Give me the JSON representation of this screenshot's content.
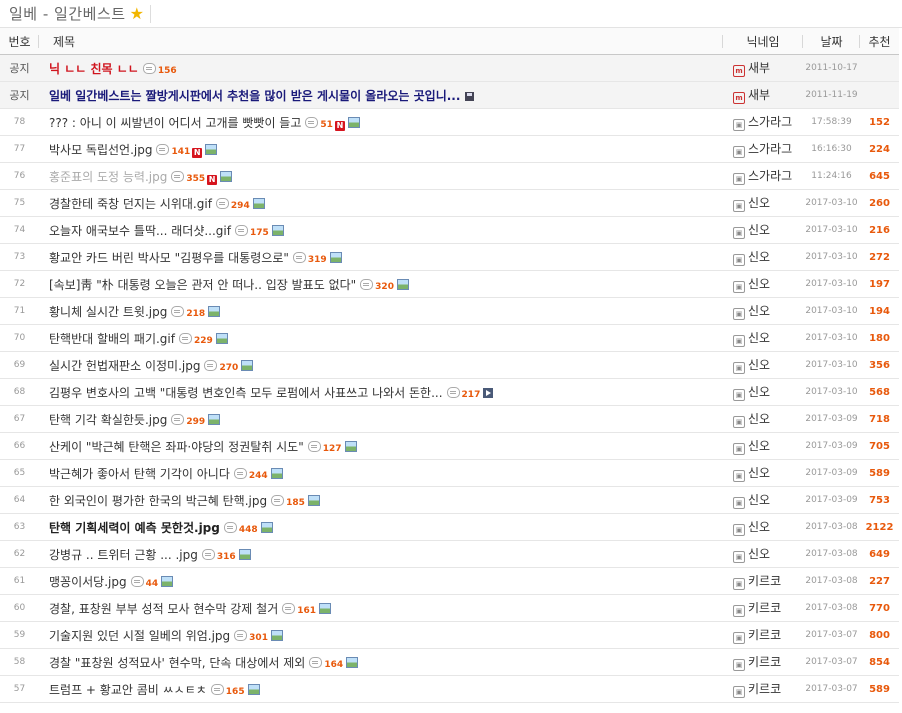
{
  "board": {
    "title": "일베 - 일간베스트",
    "star_icon": "star-icon"
  },
  "columns": {
    "no": "번호",
    "title": "제목",
    "nick": "닉네임",
    "date": "날짜",
    "rec": "추천"
  },
  "colors": {
    "accent": "#e8590c",
    "notice_red": "#d0141e",
    "notice_blue": "#1a1a7a"
  },
  "rows": [
    {
      "no": "공지",
      "title": "닉 ㄴㄴ 친목 ㄴㄴ",
      "comments": "156",
      "badge": "m",
      "nick": "새부",
      "date": "2011-10-17",
      "rec": "",
      "style": "red",
      "notice": true,
      "n": false,
      "img": false,
      "icon": ""
    },
    {
      "no": "공지",
      "title": "일베 일간베스트는 짤방게시판에서 추천을 많이 받은 게시물이 올라오는 곳입니...",
      "comments": "",
      "badge": "m",
      "nick": "새부",
      "date": "2011-11-19",
      "rec": "",
      "style": "blue",
      "notice": true,
      "n": false,
      "img": false,
      "icon": "disk"
    },
    {
      "no": "78",
      "title": "??? : 아니 이 씨발년이 어디서 고개를 빳빳이 들고",
      "comments": "51",
      "badge": "w",
      "nick": "스가라그",
      "date": "17:58:39",
      "rec": "152",
      "style": "",
      "notice": false,
      "n": true,
      "img": true,
      "icon": ""
    },
    {
      "no": "77",
      "title": "박사모 독립선언.jpg",
      "comments": "141",
      "badge": "w",
      "nick": "스가라그",
      "date": "16:16:30",
      "rec": "224",
      "style": "",
      "notice": false,
      "n": true,
      "img": true,
      "icon": ""
    },
    {
      "no": "76",
      "title": "홍준표의 도정 능력.jpg",
      "comments": "355",
      "badge": "w",
      "nick": "스가라그",
      "date": "11:24:16",
      "rec": "645",
      "style": "gray",
      "notice": false,
      "n": true,
      "img": true,
      "icon": ""
    },
    {
      "no": "75",
      "title": "경찰한테 죽창 던지는 시위대.gif",
      "comments": "294",
      "badge": "w",
      "nick": "신오",
      "date": "2017-03-10",
      "rec": "260",
      "style": "",
      "notice": false,
      "n": false,
      "img": true,
      "icon": ""
    },
    {
      "no": "74",
      "title": "오늘자 애국보수 틀딱... 래더샷...gif",
      "comments": "175",
      "badge": "w",
      "nick": "신오",
      "date": "2017-03-10",
      "rec": "216",
      "style": "",
      "notice": false,
      "n": false,
      "img": true,
      "icon": ""
    },
    {
      "no": "73",
      "title": "황교안 카드 버린 박사모 \"김평우를 대통령으로\"",
      "comments": "319",
      "badge": "w",
      "nick": "신오",
      "date": "2017-03-10",
      "rec": "272",
      "style": "",
      "notice": false,
      "n": false,
      "img": true,
      "icon": ""
    },
    {
      "no": "72",
      "title": "[속보]靑 \"朴 대통령 오늘은 관저 안 떠나.. 입장 발표도 없다\"",
      "comments": "320",
      "badge": "w",
      "nick": "신오",
      "date": "2017-03-10",
      "rec": "197",
      "style": "",
      "notice": false,
      "n": false,
      "img": true,
      "icon": ""
    },
    {
      "no": "71",
      "title": "황니체 실시간 트윗.jpg",
      "comments": "218",
      "badge": "w",
      "nick": "신오",
      "date": "2017-03-10",
      "rec": "194",
      "style": "",
      "notice": false,
      "n": false,
      "img": true,
      "icon": ""
    },
    {
      "no": "70",
      "title": "탄핵반대 할배의 패기.gif",
      "comments": "229",
      "badge": "w",
      "nick": "신오",
      "date": "2017-03-10",
      "rec": "180",
      "style": "",
      "notice": false,
      "n": false,
      "img": true,
      "icon": ""
    },
    {
      "no": "69",
      "title": "실시간 헌법재판소 이정미.jpg",
      "comments": "270",
      "badge": "w",
      "nick": "신오",
      "date": "2017-03-10",
      "rec": "356",
      "style": "",
      "notice": false,
      "n": false,
      "img": true,
      "icon": ""
    },
    {
      "no": "68",
      "title": "김평우 변호사의 고백 \"대통령 변호인측 모두 로펌에서 사표쓰고 나와서 돈한...",
      "comments": "217",
      "badge": "w",
      "nick": "신오",
      "date": "2017-03-10",
      "rec": "568",
      "style": "",
      "notice": false,
      "n": false,
      "img": false,
      "icon": "video"
    },
    {
      "no": "67",
      "title": "탄핵 기각 확실한듯.jpg",
      "comments": "299",
      "badge": "w",
      "nick": "신오",
      "date": "2017-03-09",
      "rec": "718",
      "style": "",
      "notice": false,
      "n": false,
      "img": true,
      "icon": ""
    },
    {
      "no": "66",
      "title": "산케이 \"박근혜 탄핵은 좌파·야당의 정권탈취 시도\"",
      "comments": "127",
      "badge": "w",
      "nick": "신오",
      "date": "2017-03-09",
      "rec": "705",
      "style": "",
      "notice": false,
      "n": false,
      "img": true,
      "icon": ""
    },
    {
      "no": "65",
      "title": "박근혜가 좋아서 탄핵 기각이 아니다",
      "comments": "244",
      "badge": "w",
      "nick": "신오",
      "date": "2017-03-09",
      "rec": "589",
      "style": "",
      "notice": false,
      "n": false,
      "img": true,
      "icon": ""
    },
    {
      "no": "64",
      "title": "한 외국인이 평가한 한국의 박근혜 탄핵.jpg",
      "comments": "185",
      "badge": "w",
      "nick": "신오",
      "date": "2017-03-09",
      "rec": "753",
      "style": "",
      "notice": false,
      "n": false,
      "img": true,
      "icon": ""
    },
    {
      "no": "63",
      "title": "탄핵 기획세력이 예측 못한것.jpg",
      "comments": "448",
      "badge": "w",
      "nick": "신오",
      "date": "2017-03-08",
      "rec": "2122",
      "style": "bold",
      "notice": false,
      "n": false,
      "img": true,
      "icon": ""
    },
    {
      "no": "62",
      "title": "강병규 .. 트위터 근황 ... .jpg",
      "comments": "316",
      "badge": "w",
      "nick": "신오",
      "date": "2017-03-08",
      "rec": "649",
      "style": "",
      "notice": false,
      "n": false,
      "img": true,
      "icon": ""
    },
    {
      "no": "61",
      "title": "맹꽁이서당.jpg",
      "comments": "44",
      "badge": "w",
      "nick": "키르코",
      "date": "2017-03-08",
      "rec": "227",
      "style": "",
      "notice": false,
      "n": false,
      "img": true,
      "icon": ""
    },
    {
      "no": "60",
      "title": "경찰, 표창원 부부 성적 모사 현수막 강제 철거",
      "comments": "161",
      "badge": "w",
      "nick": "키르코",
      "date": "2017-03-08",
      "rec": "770",
      "style": "",
      "notice": false,
      "n": false,
      "img": true,
      "icon": ""
    },
    {
      "no": "59",
      "title": "기술지원 있던 시절 일베의 위엄.jpg",
      "comments": "301",
      "badge": "w",
      "nick": "키르코",
      "date": "2017-03-07",
      "rec": "800",
      "style": "",
      "notice": false,
      "n": false,
      "img": true,
      "icon": ""
    },
    {
      "no": "58",
      "title": "경찰 \"표창원 성적묘사' 현수막, 단속 대상에서 제외",
      "comments": "164",
      "badge": "w",
      "nick": "키르코",
      "date": "2017-03-07",
      "rec": "854",
      "style": "",
      "notice": false,
      "n": false,
      "img": true,
      "icon": ""
    },
    {
      "no": "57",
      "title": "트럼프 + 황교안 콤비 ㅆㅅㅌㅊ",
      "comments": "165",
      "badge": "w",
      "nick": "키르코",
      "date": "2017-03-07",
      "rec": "589",
      "style": "",
      "notice": false,
      "n": false,
      "img": true,
      "icon": ""
    }
  ]
}
